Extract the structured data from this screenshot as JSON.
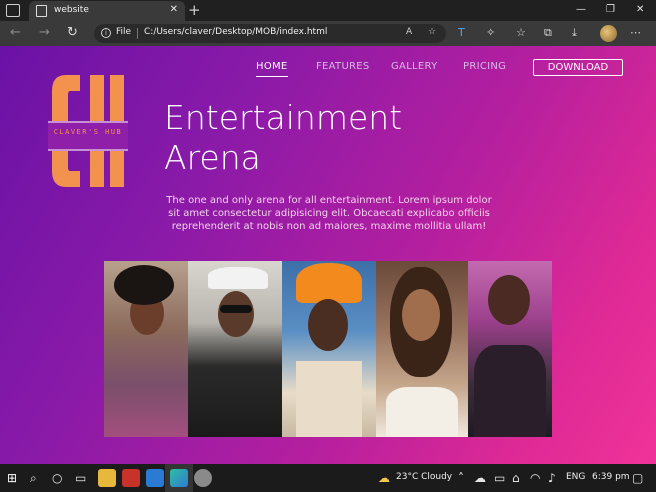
{
  "browser": {
    "tab_title": "website",
    "tab_close": "✕",
    "new_tab": "+",
    "file_label": "File",
    "url": "C:/Users/claver/Desktop/MOB/index.html",
    "window_minimize": "—",
    "window_restore": "❐",
    "window_close": "✕"
  },
  "site": {
    "logo": {
      "letters": "CH",
      "tagline": "CLAVER'S HUB",
      "color": "#f2924e"
    },
    "nav": {
      "items": [
        {
          "label": "HOME",
          "active": true
        },
        {
          "label": "FEATURES",
          "active": false
        },
        {
          "label": "GALLERY",
          "active": false
        },
        {
          "label": "PRICING",
          "active": false
        }
      ],
      "download_label": "DOWNLOAD"
    },
    "hero": {
      "title_line1": "Entertainment",
      "title_line2": "Arena",
      "description": "The one and only arena for all entertainment. Lorem ipsum dolor sit amet consectetur adipisicing elit. Obcaecati explicabo officiis reprehenderit at nobis non ad maiores, maxime mollitia ullam!"
    },
    "gradient": {
      "start": "#6a12a6",
      "end": "#f0339a"
    }
  },
  "taskbar": {
    "weather": "23°C  Cloudy",
    "language": "ENG",
    "time": "6:39 pm"
  }
}
